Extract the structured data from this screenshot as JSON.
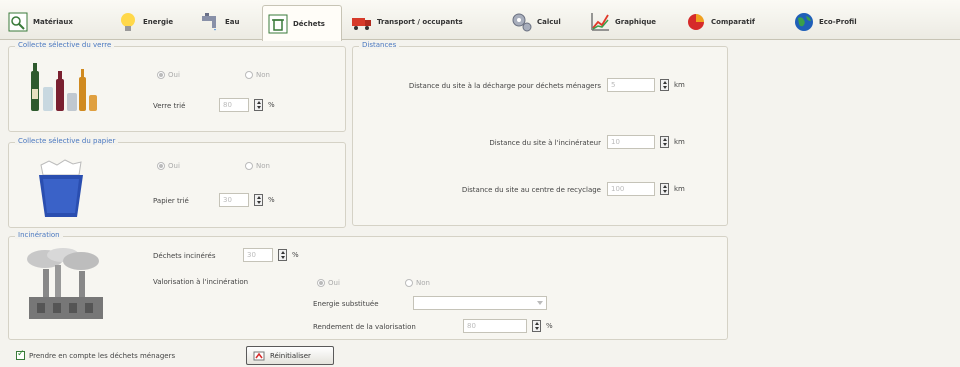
{
  "tabs": [
    {
      "label": "Matériaux",
      "icon": "materials-icon",
      "active": false
    },
    {
      "label": "Energie",
      "icon": "lightbulb-icon",
      "active": false
    },
    {
      "label": "Eau",
      "icon": "water-tap-icon",
      "active": false
    },
    {
      "label": "Déchets",
      "icon": "waste-icon",
      "active": true
    },
    {
      "label": "Transport / occupants",
      "icon": "truck-icon",
      "active": false
    },
    {
      "label": "Calcul",
      "icon": "gears-icon",
      "active": false
    },
    {
      "label": "Graphique",
      "icon": "chart-icon",
      "active": false
    },
    {
      "label": "Comparatif",
      "icon": "pie-chart-icon",
      "active": false
    },
    {
      "label": "Eco-Profil",
      "icon": "globe-icon",
      "active": false
    }
  ],
  "glass": {
    "legend": "Collecte sélective du verre",
    "oui": "Oui",
    "non": "Non",
    "rate_label": "Verre trié",
    "rate_value": "80",
    "unit": "%"
  },
  "paper": {
    "legend": "Collecte sélective du papier",
    "oui": "Oui",
    "non": "Non",
    "rate_label": "Papier trié",
    "rate_value": "30",
    "unit": "%"
  },
  "distances": {
    "legend": "Distances",
    "landfill_label": "Distance du site à la décharge pour déchets ménagers",
    "landfill_value": "5",
    "incinerator_label": "Distance du site à l'incinérateur",
    "incinerator_value": "10",
    "recycling_label": "Distance du site au centre de recyclage",
    "recycling_value": "100",
    "unit": "km"
  },
  "incineration": {
    "legend": "Incinération",
    "burned_label": "Déchets incinérés",
    "burned_value": "30",
    "unit": "%",
    "valorisation_label": "Valorisation à l'incinération",
    "oui": "Oui",
    "non": "Non",
    "substituted_label": "Energie substituée",
    "substituted_value": "",
    "efficiency_label": "Rendement de la valorisation",
    "efficiency_value": "80",
    "efficiency_unit": "%"
  },
  "footer": {
    "checkbox_label": "Prendre en compte les déchets ménagers",
    "checkbox_checked": true,
    "reset_label": "Réinitialiser"
  }
}
